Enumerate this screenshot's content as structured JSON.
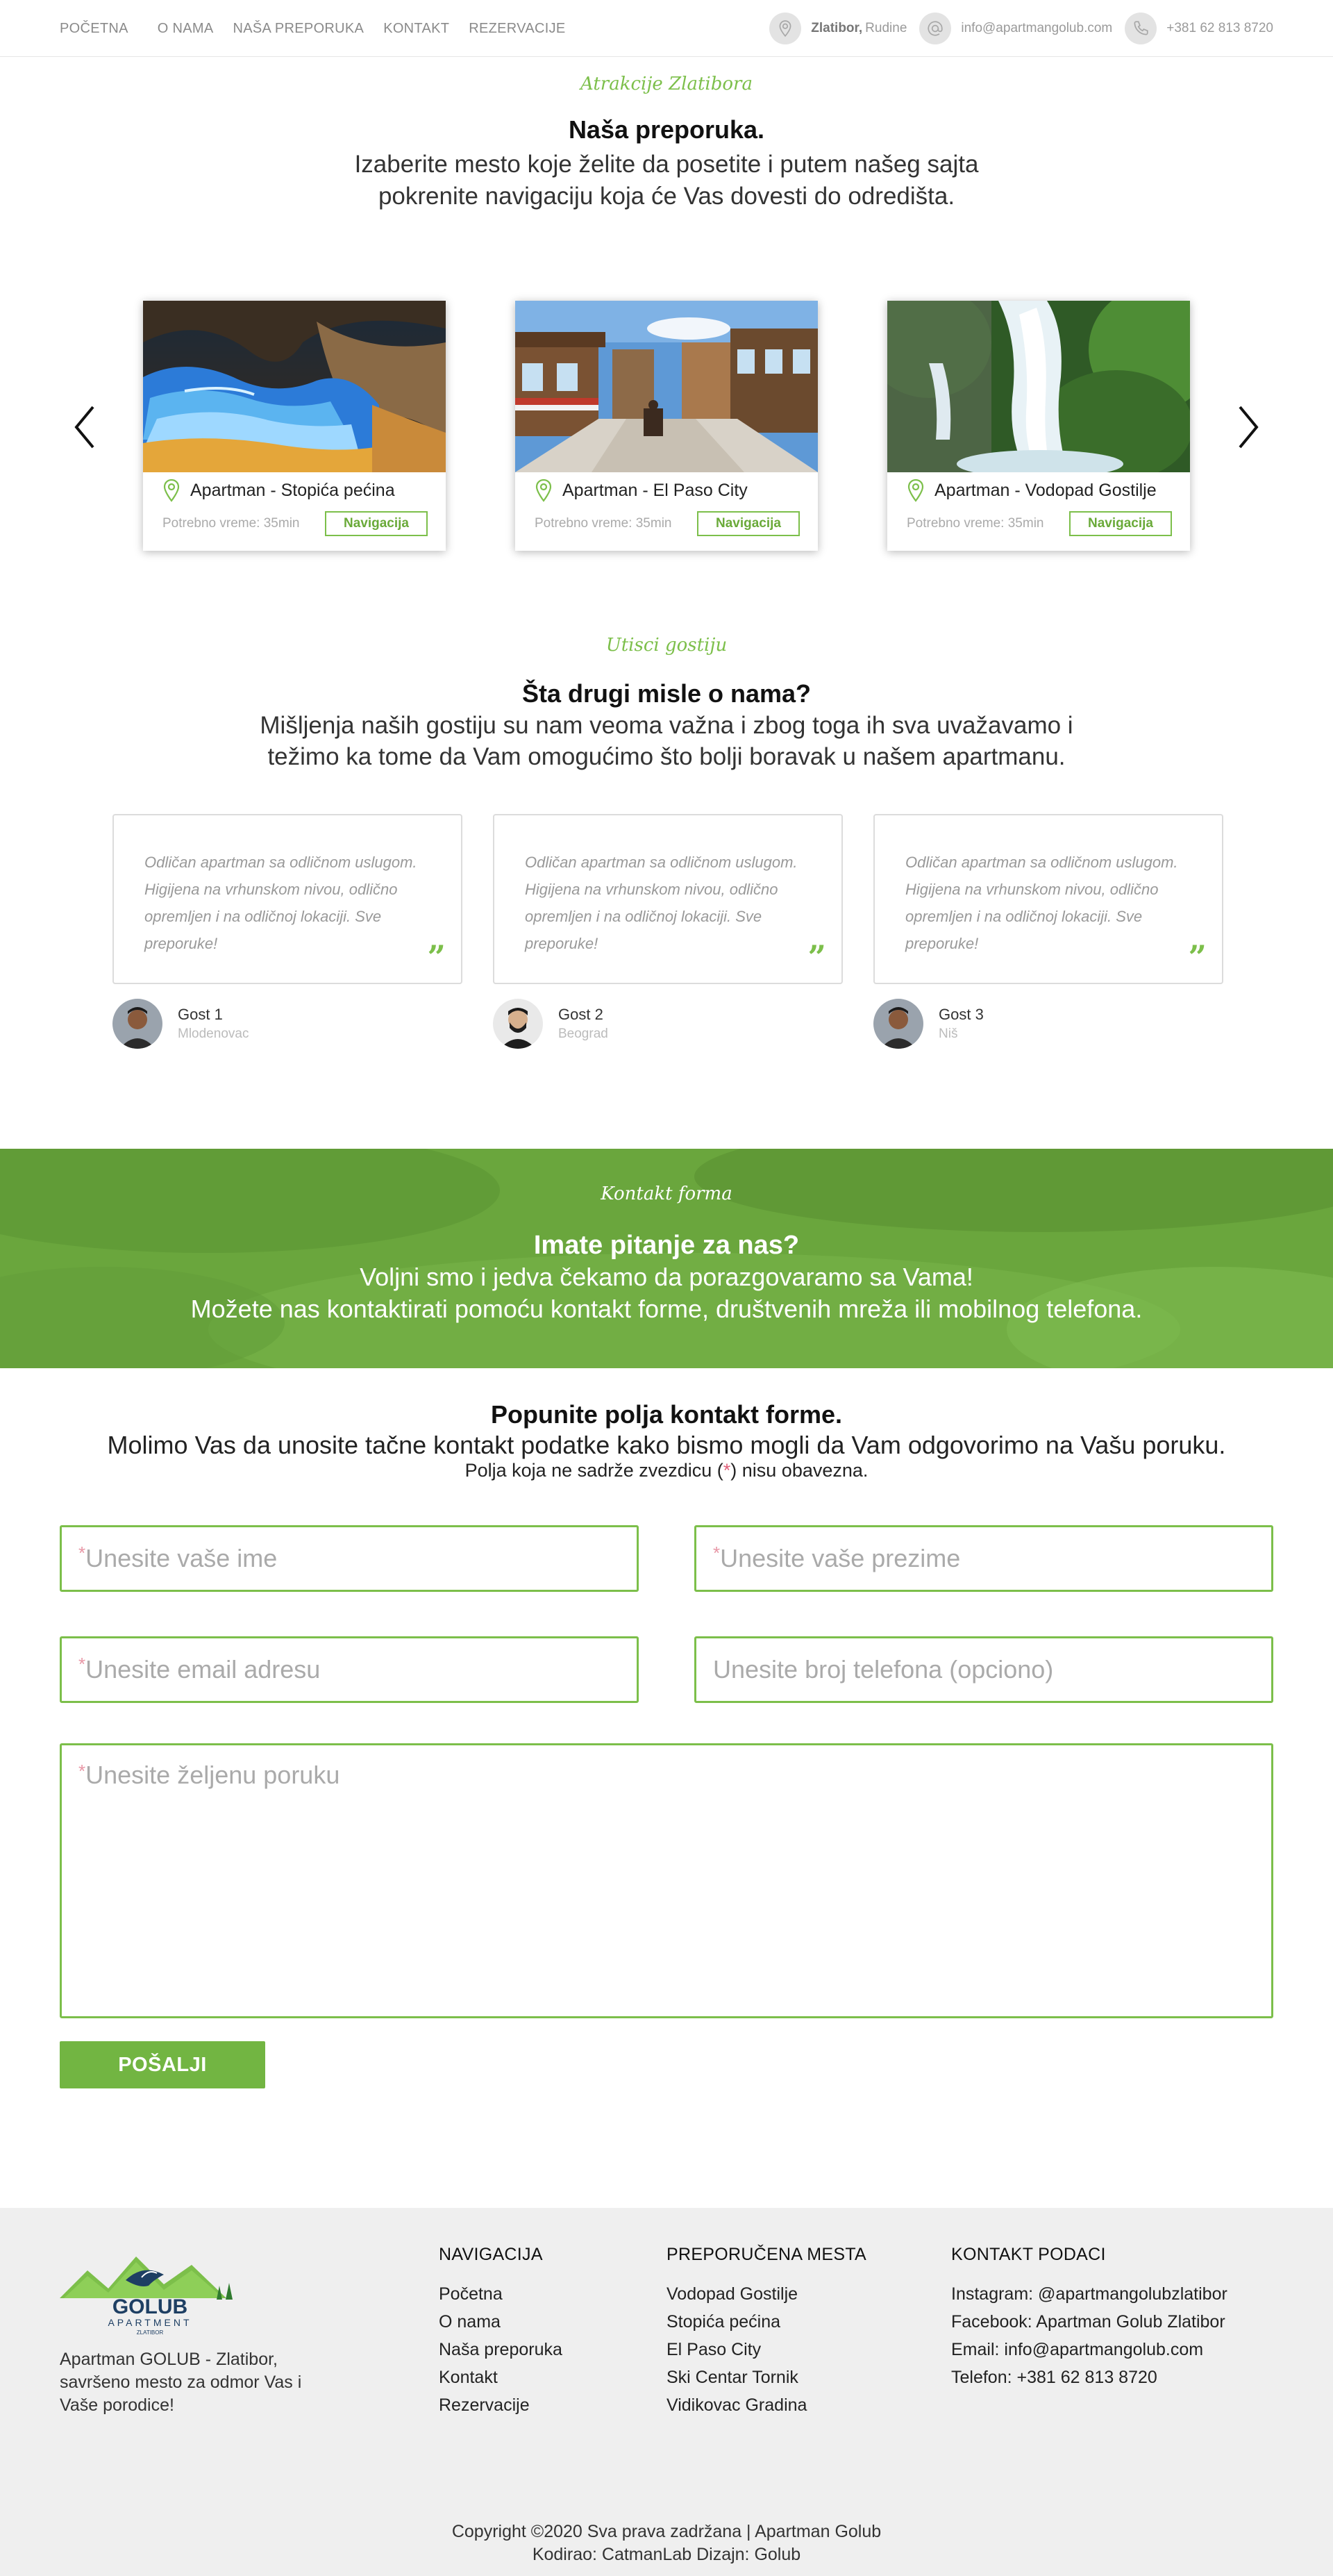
{
  "nav": {
    "items": [
      "POČETNA",
      "O NAMA",
      "NAŠA PREPORUKA",
      "KONTAKT",
      "REZERVACIJE"
    ]
  },
  "topinfo": {
    "location_bold": "Zlatibor,",
    "location_rest": " Rudine",
    "email": "info@apartmangolub.com",
    "phone": "+381 62 813 8720",
    "icons": [
      "location-pin-icon",
      "at-sign-icon",
      "phone-icon"
    ]
  },
  "recommend": {
    "script": "Atrakcije Zlatibora",
    "title": "Naša preporuka.",
    "line1": "Izaberite mesto koje želite da posetite i putem našeg sajta",
    "line2": "pokrenite navigaciju koja će Vas dovesti do odredišta.",
    "cards": [
      {
        "title": "Apartman - Stopića pećina",
        "time": "Potrebno vreme: 35min",
        "button": "Navigacija"
      },
      {
        "title": "Apartman - El Paso City",
        "time": "Potrebno vreme: 35min",
        "button": "Navigacija"
      },
      {
        "title": "Apartman - Vodopad Gostilje",
        "time": "Potrebno vreme: 35min",
        "button": "Navigacija"
      }
    ]
  },
  "testimonials": {
    "script": "Utisci gostiju",
    "title": "Šta drugi misle o nama?",
    "line1": "Mišljenja naših gostiju su nam veoma važna i zbog toga ih sva uvažavamo i",
    "line2": "težimo ka tome da Vam omogućimo što bolji boravak u našem apartmanu.",
    "items": [
      {
        "text": "Odličan apartman sa odličnom uslugom. Higijena na vrhunskom nivou, odlično opremljen i na odličnoj lokaciji. Sve preporuke!",
        "name": "Gost 1",
        "city": "Mlodenovac"
      },
      {
        "text": "Odličan apartman sa odličnom uslugom. Higijena na vrhunskom nivou, odlično opremljen i na odličnoj lokaciji. Sve preporuke!",
        "name": "Gost 2",
        "city": "Beograd"
      },
      {
        "text": "Odličan apartman sa odličnom uslugom. Higijena na vrhunskom nivou, odlično opremljen i na odličnoj lokaciji. Sve preporuke!",
        "name": "Gost 3",
        "city": "Niš"
      }
    ],
    "quote_mark": "”"
  },
  "banner": {
    "script": "Kontakt forma",
    "title": "Imate pitanje za nas?",
    "line1": "Voljni smo i jedva čekamo da porazgovaramo sa Vama!",
    "line2": "Možete nas kontaktirati pomoću kontakt forme, društvenih mreža ili mobilnog telefona."
  },
  "form": {
    "title": "Popunite polja kontakt forme.",
    "subtitle": "Molimo Vas da unosite tačne kontakt podatke kako bismo mogli da Vam odgovorimo na Vašu poruku.",
    "note_before": "Polja koja ne sadrže zvezdicu (",
    "note_star": "*",
    "note_after": ") nisu obavezna.",
    "first_name": "Unesite vaše ime",
    "last_name": "Unesite vaše prezime",
    "email": "Unesite email adresu",
    "phone": "Unesite broj telefona (opciono)",
    "message": "Unesite željenu poruku",
    "required_mark": "*",
    "submit": "POŠALJI"
  },
  "footer": {
    "logo_text": "GOLUB",
    "logo_sub": "APARTMENT",
    "logo_small": "ZLATIBOR",
    "description": "Apartman GOLUB - Zlatibor, savršeno mesto za odmor Vas i Vaše porodice!",
    "nav_title": "NAVIGACIJA",
    "nav_items": [
      "Početna",
      "O nama",
      "Naša preporuka",
      "Kontakt",
      "Rezervacije"
    ],
    "places_title": "PREPORUČENA MESTA",
    "places_items": [
      "Vodopad Gostilje",
      "Stopića pećina",
      "El Paso City",
      "Ski Centar Tornik",
      "Vidikovac Gradina"
    ],
    "contact_title": "KONTAKT PODACI",
    "contact_items": [
      "Instagram: @apartmangolubzlatibor",
      "Facebook: Apartman Golub Zlatibor",
      "Email: info@apartmangolub.com",
      "Telefon: +381 62 813 8720"
    ],
    "copyright1": "Copyright ©2020 Sva prava zadržana | Apartman Golub",
    "copyright2": "Kodirao: CatmanLab Dizajn: Golub"
  },
  "colors": {
    "accent": "#7cbf4a",
    "button": "#72b542",
    "footer_bg": "#efefef",
    "required": "#e897a6"
  }
}
